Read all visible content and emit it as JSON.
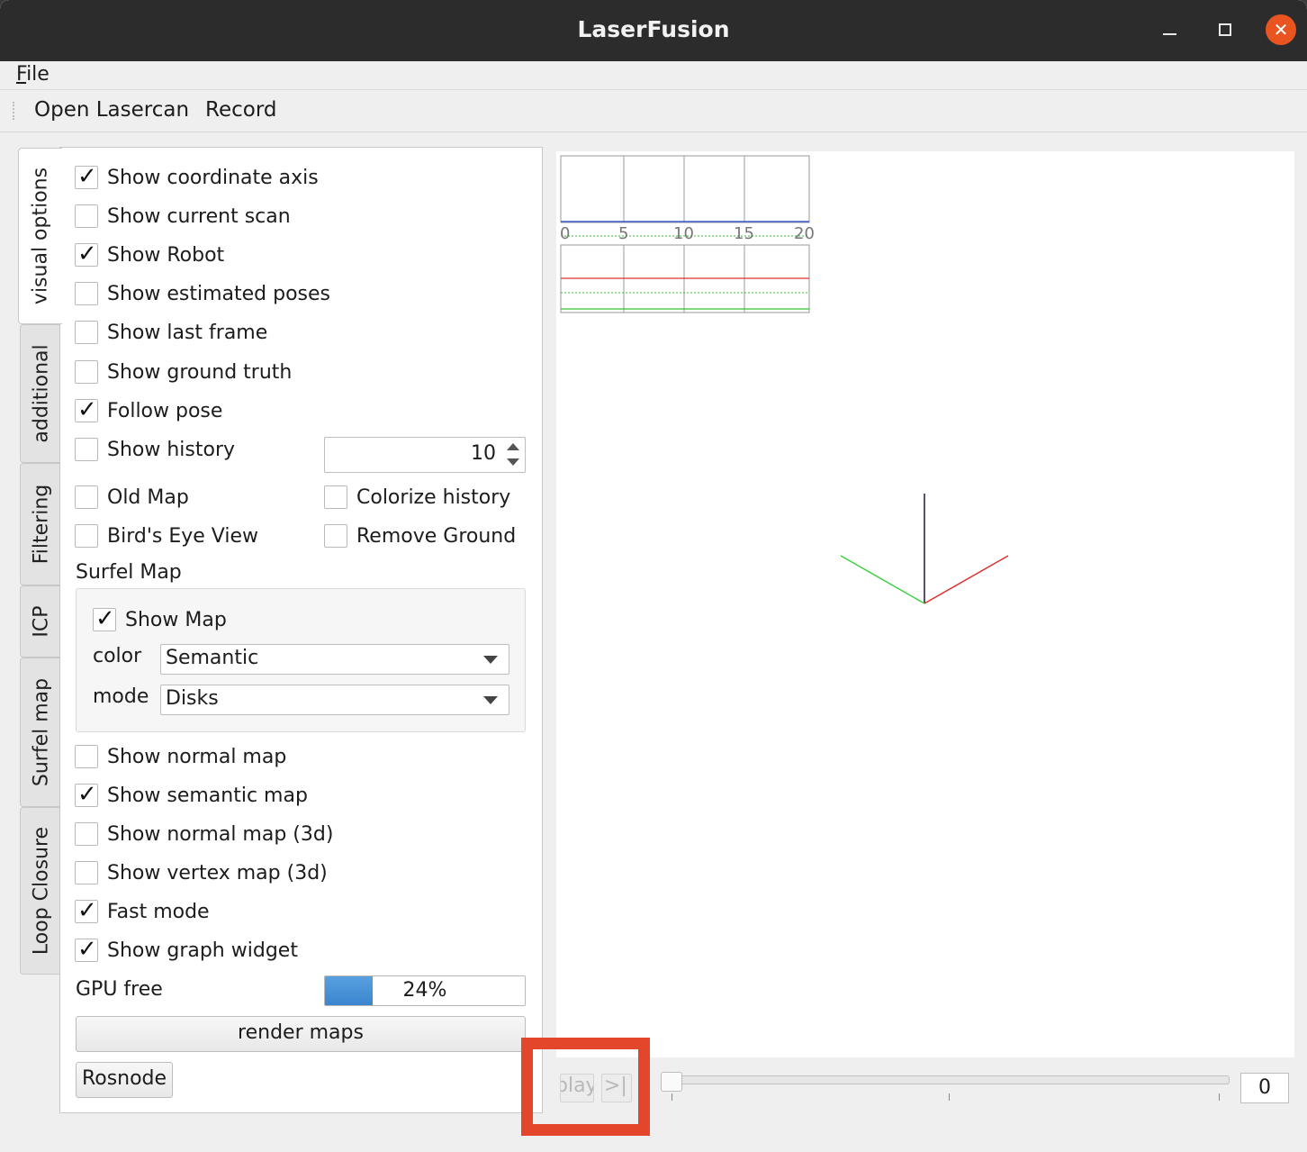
{
  "window": {
    "title": "LaserFusion",
    "controls": {
      "minimize": "minimize-icon",
      "maximize": "maximize-icon",
      "close": "close-icon"
    },
    "close_color": "#e95420"
  },
  "menubar": {
    "file_mnemonic": "F",
    "file_rest": "ile"
  },
  "toolbar": {
    "open_lasercan": "Open Lasercan",
    "record": "Record"
  },
  "tabs": [
    "visual options",
    "additional",
    "Filtering",
    "ICP",
    "Surfel map",
    "Loop Closure"
  ],
  "active_tab": "visual options",
  "visual_options": {
    "show_coordinate_axis": {
      "label": "Show coordinate axis",
      "checked": true
    },
    "show_current_scan": {
      "label": "Show current scan",
      "checked": false
    },
    "show_robot": {
      "label": "Show Robot",
      "checked": true
    },
    "show_estimated_poses": {
      "label": "Show estimated poses",
      "checked": false
    },
    "show_last_frame": {
      "label": "Show last frame",
      "checked": false
    },
    "show_ground_truth": {
      "label": "Show ground truth",
      "checked": false
    },
    "follow_pose": {
      "label": "Follow pose",
      "checked": true
    },
    "show_history": {
      "label": "Show history",
      "checked": false
    },
    "history_count": "10",
    "old_map": {
      "label": "Old Map",
      "checked": false
    },
    "colorize_history": {
      "label": "Colorize history",
      "checked": false
    },
    "birds_eye_view": {
      "label": "Bird's Eye View",
      "checked": false
    },
    "remove_ground": {
      "label": "Remove Ground",
      "checked": false
    },
    "surfel_map_title": "Surfel Map",
    "surfel_show_map": {
      "label": "Show Map",
      "checked": true
    },
    "color_label": "color",
    "color_value": "Semantic",
    "mode_label": "mode",
    "mode_value": "Disks",
    "show_normal_map": {
      "label": "Show normal map",
      "checked": false
    },
    "show_semantic_map": {
      "label": "Show semantic map",
      "checked": true
    },
    "show_normal_map_3d": {
      "label": "Show normal map (3d)",
      "checked": false
    },
    "show_vertex_map_3d": {
      "label": "Show vertex map (3d)",
      "checked": false
    },
    "fast_mode": {
      "label": "Fast mode",
      "checked": true
    },
    "show_graph_widget": {
      "label": "Show graph widget",
      "checked": true
    },
    "gpu_free_label": "GPU free",
    "gpu_free_text": "24%",
    "gpu_free_fraction": 0.24,
    "render_maps": "render maps",
    "rosnode": "Rosnode"
  },
  "graph_widget": {
    "x_ticks": [
      "0",
      "5",
      "10",
      "15",
      "20"
    ],
    "colors": {
      "blue": "#3a5fd0",
      "red": "#e03030",
      "green": "#30c030"
    }
  },
  "axes_colors": {
    "x": "#e03030",
    "y": "#40d040",
    "z": "#1a1a4a"
  },
  "playback": {
    "play_label": "play",
    "step_label": ">|",
    "frame": "0"
  },
  "highlight_color": "#e4462b"
}
